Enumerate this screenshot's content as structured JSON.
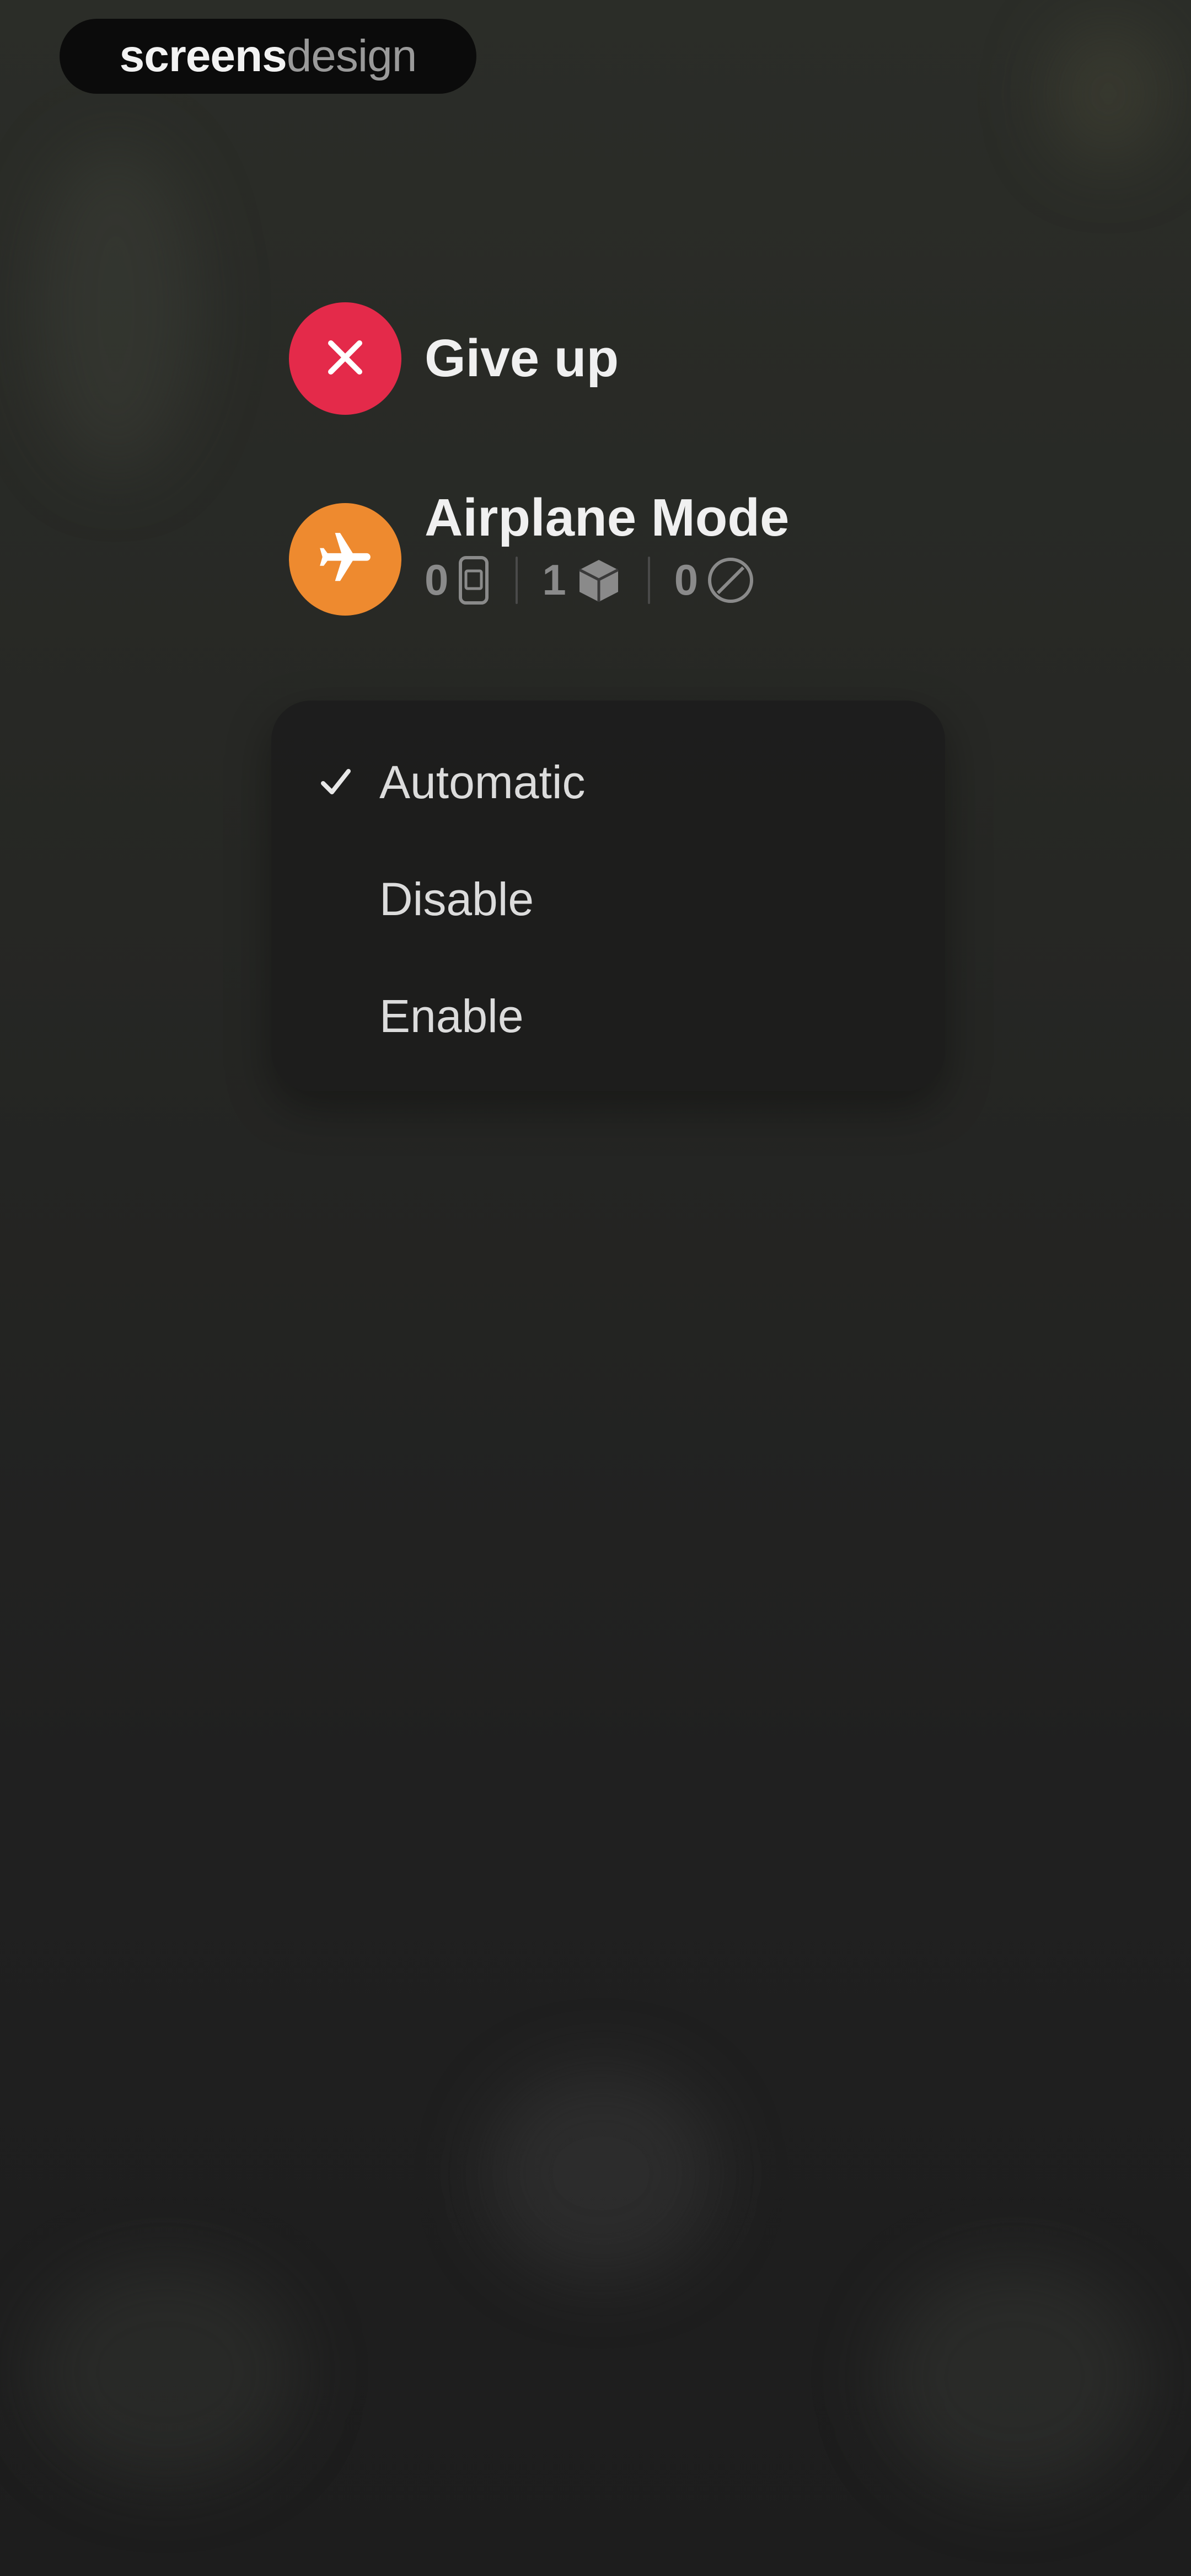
{
  "watermark": {
    "strong": "screens",
    "light": "design"
  },
  "actions": {
    "give_up": {
      "label": "Give up",
      "icon": "close-icon",
      "color": "#e42a4a"
    },
    "airplane": {
      "label": "Airplane Mode",
      "icon": "airplane-icon",
      "color": "#ee8a2f",
      "stats": [
        {
          "value": "0",
          "icon": "phone-icon"
        },
        {
          "value": "1",
          "icon": "box-icon"
        },
        {
          "value": "0",
          "icon": "blocked-icon"
        }
      ]
    }
  },
  "menu": {
    "items": [
      {
        "label": "Automatic",
        "selected": true
      },
      {
        "label": "Disable",
        "selected": false
      },
      {
        "label": "Enable",
        "selected": false
      }
    ]
  }
}
